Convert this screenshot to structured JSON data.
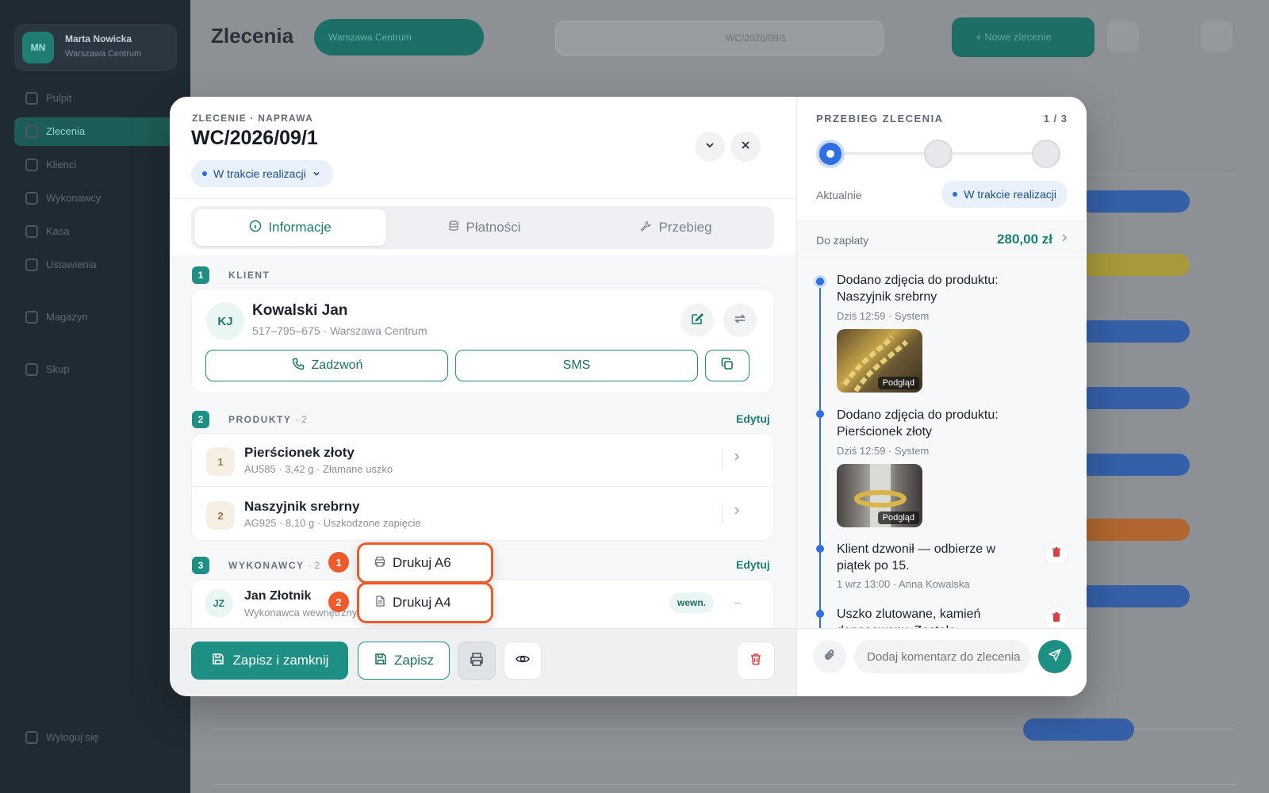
{
  "background": {
    "user_initials": "MN",
    "user_name": "Marta Nowicka",
    "user_sub": "Warszawa Centrum",
    "nav": [
      "Pulpit",
      "Zlecenia",
      "Klienci",
      "Wykonawcy",
      "Kasa",
      "Ustawienia",
      "Magazyn",
      "Skup"
    ],
    "logout": "Wyloguj się",
    "page_title": "Zlecenia",
    "location_pill": "Warszawa Centrum",
    "search_value": "WC/2026/09/1",
    "new_button": "+ Nowe zlecenie"
  },
  "modal": {
    "eyebrow": "ZLECENIE · NAPRAWA",
    "title": "WC/2026/09/1",
    "status": "W trakcie realizacji",
    "tabs": [
      {
        "label": "Informacje",
        "icon": "info-icon"
      },
      {
        "label": "Płatności",
        "icon": "database-icon"
      },
      {
        "label": "Przebieg",
        "icon": "wrench-icon"
      }
    ],
    "client_section": {
      "num": "1",
      "label": "KLIENT"
    },
    "client": {
      "initials": "KJ",
      "name": "Kowalski Jan",
      "sub": "517–795–675 · Warszawa Centrum",
      "call": "Zadzwoń",
      "sms": "SMS"
    },
    "products_section": {
      "num": "2",
      "label": "PRODUKTY",
      "count": "· 2",
      "edit": "Edytuj"
    },
    "products": [
      {
        "num": "1",
        "name": "Pierścionek złoty",
        "sub": "AU585 · 3,42 g · Złamane uszko"
      },
      {
        "num": "2",
        "name": "Naszyjnik srebrny",
        "sub": "AG925 · 8,10 g · Uszkodzone zapięcie"
      }
    ],
    "performers_section": {
      "num": "3",
      "label": "WYKONAWCY",
      "count": "· 2",
      "edit": "Edytuj"
    },
    "performer": {
      "initials": "JZ",
      "name": "Jan Złotnik",
      "sub": "Wykonawca wewnętrzny",
      "badge": "wewn.",
      "dash": "–"
    },
    "print_menu": [
      {
        "marker": "1",
        "label": "Drukuj A6",
        "icon": "printer-icon"
      },
      {
        "marker": "2",
        "label": "Drukuj A4",
        "icon": "document-icon"
      }
    ],
    "footer": {
      "save_close": "Zapisz i zamknij",
      "save": "Zapisz"
    }
  },
  "side": {
    "eyebrow": "PRZEBIEG ZLECENIA",
    "step_count": "1 / 3",
    "now_label": "Aktualnie",
    "status": "W trakcie realizacji",
    "pay_label": "Do zapłaty",
    "pay_amount": "280,00 zł",
    "events": [
      {
        "title": "Dodano zdjęcia do produktu: Naszyjnik srebrny",
        "meta": "Dziś 12:59 · System",
        "thumb_caption": "Podgląd"
      },
      {
        "title": "Dodano zdjęcia do produktu: Pierścionek złoty",
        "meta": "Dziś 12:59 · System",
        "thumb_caption": "Podgląd"
      },
      {
        "title": "Klient dzwonił — odbierze w piątek po 15.",
        "meta": "1 wrz 13:00 · Anna Kowalska"
      },
      {
        "title": "Uszko zlutowane, kamień dopasowany. Zostało...",
        "meta": ""
      }
    ],
    "comment_placeholder": "Dodaj komentarz do zlecenia"
  },
  "colors": {
    "accent": "#1e8f83",
    "status_blue": "#2f6fe4",
    "marker": "#ef5a2b",
    "danger": "#d94040"
  }
}
